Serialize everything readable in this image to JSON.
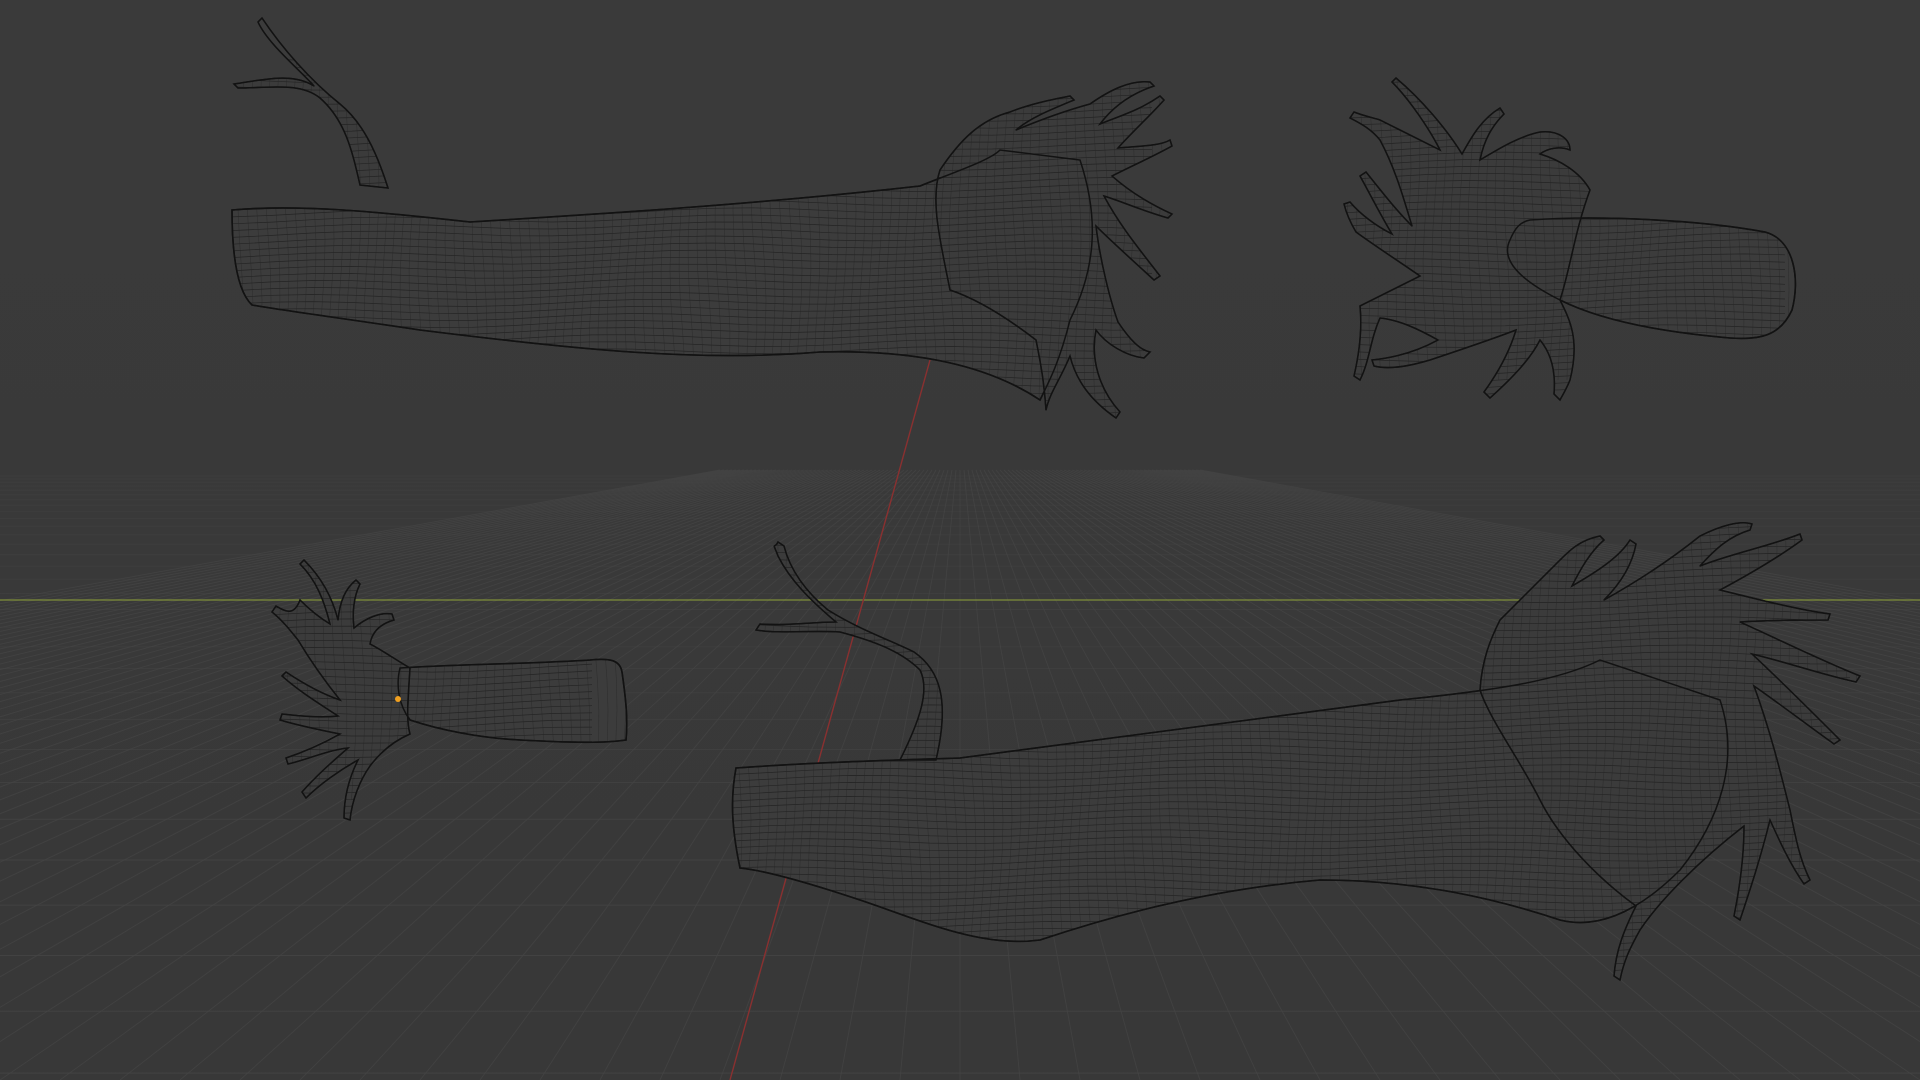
{
  "app": {
    "name": "",
    "view": "3D Viewport",
    "shading": "wireframe"
  },
  "viewport": {
    "background_color": "#393939",
    "grid_color": "#454545",
    "x_axis_color": "#7a2a2a",
    "y_axis_color": "#8a9a3a",
    "selection_origin_color": "#f0a020"
  },
  "objects": [
    {
      "id": "trunk-side-top",
      "kind": "mesh"
    },
    {
      "id": "trunk-end-top",
      "kind": "mesh"
    },
    {
      "id": "trunk-end-bottom",
      "kind": "mesh"
    },
    {
      "id": "trunk-side-bottom",
      "kind": "mesh"
    }
  ]
}
